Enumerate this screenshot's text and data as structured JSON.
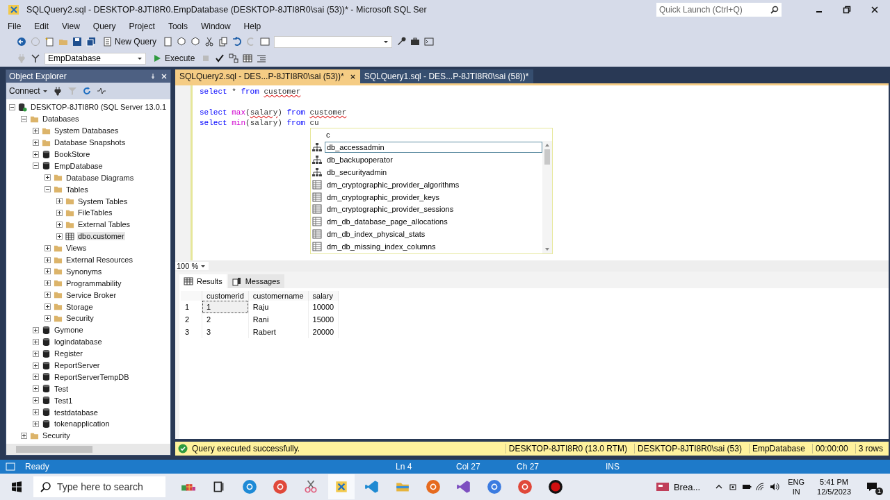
{
  "window": {
    "title": "SQLQuery2.sql - DESKTOP-8JTI8R0.EmpDatabase (DESKTOP-8JTI8R0\\sai (53))* - Microsoft SQL Ser"
  },
  "quick_launch": {
    "placeholder": "Quick Launch (Ctrl+Q)"
  },
  "menu": [
    "File",
    "Edit",
    "View",
    "Query",
    "Project",
    "Tools",
    "Window",
    "Help"
  ],
  "toolbar": {
    "new_query": "New Query",
    "database": "EmpDatabase",
    "execute": "Execute"
  },
  "object_explorer": {
    "title": "Object Explorer",
    "connect": "Connect",
    "tree": [
      {
        "label": "DESKTOP-8JTI8R0 (SQL Server 13.0.1",
        "kind": "server",
        "expanded": true,
        "children": [
          {
            "label": "Databases",
            "kind": "folder",
            "expanded": true,
            "children": [
              {
                "label": "System Databases",
                "kind": "folder",
                "expanded": false
              },
              {
                "label": "Database Snapshots",
                "kind": "folder",
                "expanded": false
              },
              {
                "label": "BookStore",
                "kind": "database",
                "expanded": false
              },
              {
                "label": "EmpDatabase",
                "kind": "database",
                "expanded": true,
                "children": [
                  {
                    "label": "Database Diagrams",
                    "kind": "folder",
                    "expanded": false
                  },
                  {
                    "label": "Tables",
                    "kind": "folder",
                    "expanded": true,
                    "children": [
                      {
                        "label": "System Tables",
                        "kind": "folder",
                        "expanded": false
                      },
                      {
                        "label": "FileTables",
                        "kind": "folder",
                        "expanded": false
                      },
                      {
                        "label": "External Tables",
                        "kind": "folder",
                        "expanded": false
                      },
                      {
                        "label": "dbo.customer",
                        "kind": "table",
                        "expanded": false,
                        "selected": true
                      }
                    ]
                  },
                  {
                    "label": "Views",
                    "kind": "folder",
                    "expanded": false
                  },
                  {
                    "label": "External Resources",
                    "kind": "folder",
                    "expanded": false
                  },
                  {
                    "label": "Synonyms",
                    "kind": "folder",
                    "expanded": false
                  },
                  {
                    "label": "Programmability",
                    "kind": "folder",
                    "expanded": false
                  },
                  {
                    "label": "Service Broker",
                    "kind": "folder",
                    "expanded": false
                  },
                  {
                    "label": "Storage",
                    "kind": "folder",
                    "expanded": false
                  },
                  {
                    "label": "Security",
                    "kind": "folder",
                    "expanded": false
                  }
                ]
              },
              {
                "label": "Gymone",
                "kind": "database",
                "expanded": false
              },
              {
                "label": "logindatabase",
                "kind": "database",
                "expanded": false
              },
              {
                "label": "Register",
                "kind": "database",
                "expanded": false
              },
              {
                "label": "ReportServer",
                "kind": "database",
                "expanded": false
              },
              {
                "label": "ReportServerTempDB",
                "kind": "database",
                "expanded": false
              },
              {
                "label": "Test",
                "kind": "database",
                "expanded": false
              },
              {
                "label": "Test1",
                "kind": "database",
                "expanded": false
              },
              {
                "label": "testdatabase",
                "kind": "database",
                "expanded": false
              },
              {
                "label": "tokenapplication",
                "kind": "database",
                "expanded": false
              }
            ]
          },
          {
            "label": "Security",
            "kind": "folder",
            "expanded": false
          }
        ]
      }
    ]
  },
  "editor_tabs": [
    {
      "label": "SQLQuery2.sql - DES...P-8JTI8R0\\sai (53))*",
      "selected": true
    },
    {
      "label": "SQLQuery1.sql - DES...P-8JTI8R0\\sai (58))*",
      "selected": false
    }
  ],
  "editor": {
    "zoom": "100 %",
    "lines": [
      {
        "kind": "code",
        "tokens": [
          {
            "text": "select",
            "kind": "keyword"
          },
          {
            "text": " * ",
            "kind": "plain"
          },
          {
            "text": "from ",
            "kind": "keyword"
          },
          {
            "text": "customer",
            "kind": "error"
          }
        ]
      },
      {
        "kind": "blank"
      },
      {
        "kind": "code",
        "tokens": [
          {
            "text": "select ",
            "kind": "keyword"
          },
          {
            "text": "max",
            "kind": "function"
          },
          {
            "text": "(",
            "kind": "plain"
          },
          {
            "text": "salary",
            "kind": "error"
          },
          {
            "text": ") ",
            "kind": "plain"
          },
          {
            "text": "from ",
            "kind": "keyword"
          },
          {
            "text": "customer",
            "kind": "error"
          }
        ]
      },
      {
        "kind": "code",
        "tokens": [
          {
            "text": "select ",
            "kind": "keyword"
          },
          {
            "text": "min",
            "kind": "function"
          },
          {
            "text": "(salary) ",
            "kind": "plain"
          },
          {
            "text": "from",
            "kind": "keyword"
          },
          {
            "text": " cu",
            "kind": "plain"
          }
        ]
      }
    ]
  },
  "autocomplete": {
    "filter": "c",
    "items": [
      {
        "label": "db_accessadmin",
        "kind": "role",
        "selected": true
      },
      {
        "label": "db_backupoperator",
        "kind": "role",
        "selected": false
      },
      {
        "label": "db_securityadmin",
        "kind": "role",
        "selected": false
      },
      {
        "label": "dm_cryptographic_provider_algorithms",
        "kind": "view",
        "selected": false
      },
      {
        "label": "dm_cryptographic_provider_keys",
        "kind": "view",
        "selected": false
      },
      {
        "label": "dm_cryptographic_provider_sessions",
        "kind": "view",
        "selected": false
      },
      {
        "label": "dm_db_database_page_allocations",
        "kind": "view",
        "selected": false
      },
      {
        "label": "dm_db_index_physical_stats",
        "kind": "view",
        "selected": false
      },
      {
        "label": "dm_db_missing_index_columns",
        "kind": "view",
        "selected": false
      }
    ]
  },
  "results_tabs": [
    {
      "label": "Results",
      "kind": "grid",
      "selected": true
    },
    {
      "label": "Messages",
      "kind": "messages",
      "selected": false
    }
  ],
  "results": {
    "columns": [
      "customerid",
      "customername",
      "salary"
    ],
    "rows": [
      {
        "number": "1",
        "cells": [
          {
            "text": "1",
            "focused": true
          },
          {
            "text": "Raju",
            "focused": false
          },
          {
            "text": "10000",
            "focused": false
          }
        ]
      },
      {
        "number": "2",
        "cells": [
          {
            "text": "2",
            "focused": false
          },
          {
            "text": "Rani",
            "focused": false
          },
          {
            "text": "15000",
            "focused": false
          }
        ]
      },
      {
        "number": "3",
        "cells": [
          {
            "text": "3",
            "focused": false
          },
          {
            "text": "Rabert",
            "focused": false
          },
          {
            "text": "20000",
            "focused": false
          }
        ]
      }
    ]
  },
  "query_status": {
    "message": "Query executed successfully.",
    "server": "DESKTOP-8JTI8R0 (13.0 RTM)",
    "user": "DESKTOP-8JTI8R0\\sai (53)",
    "database": "EmpDatabase",
    "elapsed": "00:00:00",
    "rows": "3 rows"
  },
  "status_bar": {
    "state": "Ready",
    "line": "Ln 4",
    "column": "Col 27",
    "char": "Ch 27",
    "mode": "INS"
  },
  "taskbar": {
    "search_placeholder": "Type here to search",
    "apps": [
      {
        "kind": "widgets",
        "selected": false
      },
      {
        "kind": "taskview",
        "selected": false
      },
      {
        "kind": "edge",
        "selected": false
      },
      {
        "kind": "chrome",
        "selected": false
      },
      {
        "kind": "snip",
        "selected": false
      },
      {
        "kind": "ssms",
        "selected": true
      },
      {
        "kind": "vscode",
        "selected": false
      },
      {
        "kind": "files",
        "selected": false
      },
      {
        "kind": "firefox",
        "selected": false
      },
      {
        "kind": "vs",
        "selected": false
      },
      {
        "kind": "copilot",
        "selected": false
      },
      {
        "kind": "chrome",
        "selected": false
      },
      {
        "kind": "record",
        "selected": false
      }
    ],
    "weather": "Brea...",
    "language": "ENG",
    "region": "IN",
    "time": "5:41 PM",
    "date": "12/5/2023",
    "notifications": "1"
  }
}
